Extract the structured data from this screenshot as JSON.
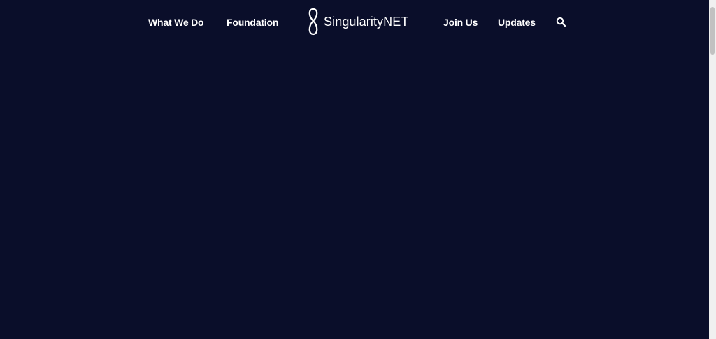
{
  "nav": {
    "left_items": [
      {
        "label": "What We Do"
      },
      {
        "label": "Foundation"
      }
    ],
    "logo": {
      "text": "SingularityNET",
      "icon": "singularitynet-logo-icon"
    },
    "right_items": [
      {
        "label": "Join Us"
      },
      {
        "label": "Updates"
      }
    ],
    "search": {
      "icon": "search-icon"
    }
  },
  "colors": {
    "background": "#0a0e2a",
    "text": "#ffffff",
    "divider": "#c9cbd6",
    "scrollbar_track": "#f0f0f0",
    "scrollbar_thumb": "#c1c1c1"
  }
}
